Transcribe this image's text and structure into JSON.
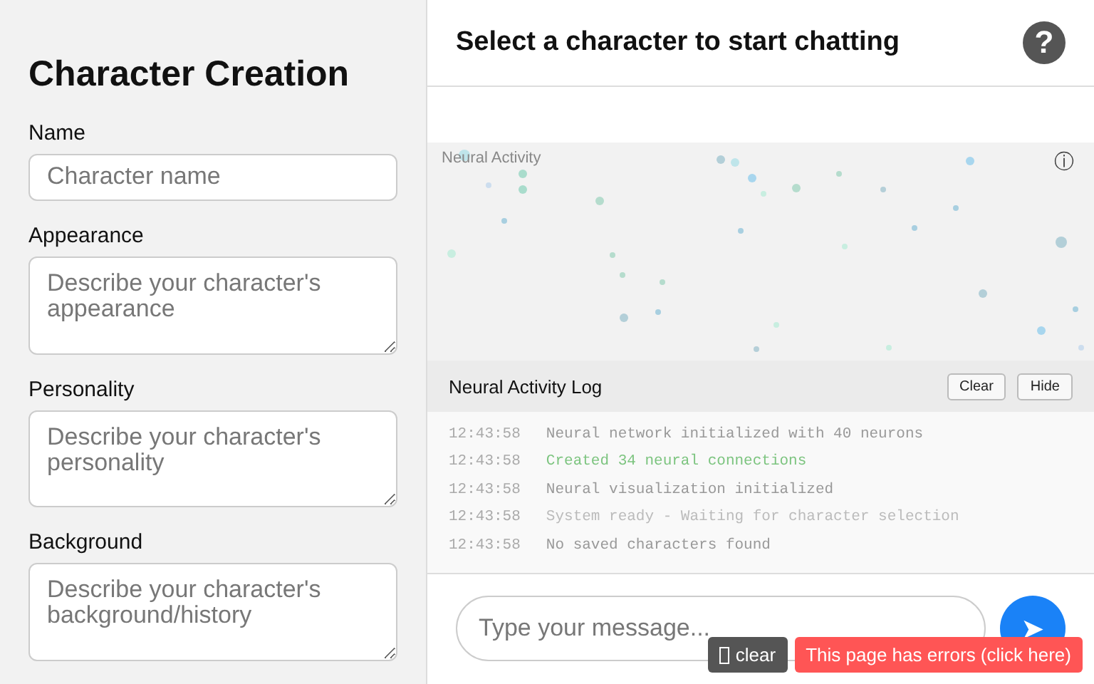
{
  "creation": {
    "title": "Character Creation",
    "fields": [
      {
        "label": "Name",
        "kind": "input",
        "placeholder": "Character name"
      },
      {
        "label": "Appearance",
        "kind": "textarea",
        "placeholder": "Describe your character's appearance"
      },
      {
        "label": "Personality",
        "kind": "textarea",
        "placeholder": "Describe your character's personality"
      },
      {
        "label": "Background",
        "kind": "textarea",
        "placeholder": "Describe your character's background/history"
      }
    ]
  },
  "chat": {
    "title": "Select a character to start chatting",
    "help": "?",
    "message_placeholder": "Type your message...",
    "send": "➤"
  },
  "neural": {
    "label": "Neural Activity",
    "info": "ⓘ"
  },
  "log": {
    "title": "Neural Activity Log",
    "buttons": [
      "Clear",
      "Hide"
    ],
    "entries": [
      {
        "time": "12:43:58",
        "text": "Neural network initialized with 40 neurons",
        "kind": "info"
      },
      {
        "time": "12:43:58",
        "text": "Created 34 neural connections",
        "kind": "success"
      },
      {
        "time": "12:43:58",
        "text": "Neural visualization initialized",
        "kind": "info"
      },
      {
        "time": "12:43:58",
        "text": "System ready - Waiting for character selection",
        "kind": "system"
      },
      {
        "time": "12:43:58",
        "text": "No saved characters found",
        "kind": "info"
      }
    ]
  },
  "overlay": {
    "clear": "clear",
    "error": "This page has errors (click here)"
  }
}
